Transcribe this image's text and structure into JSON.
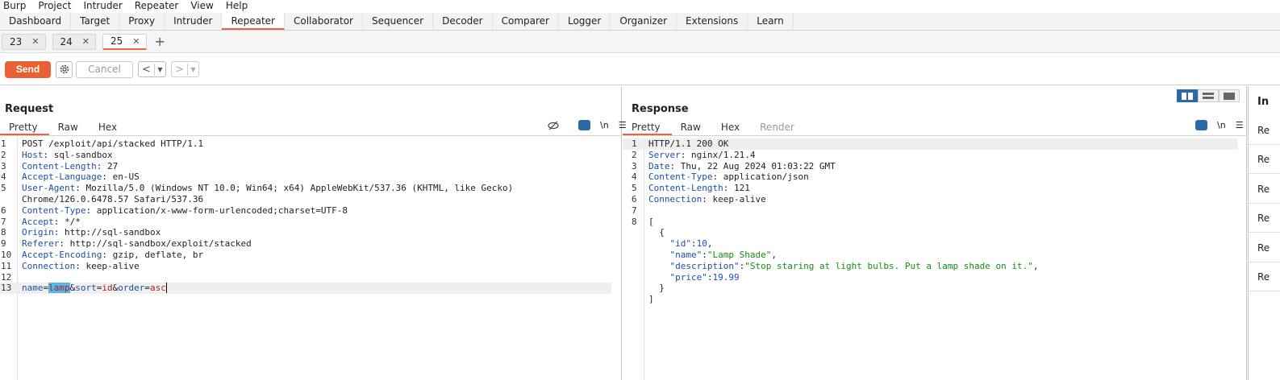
{
  "menu": [
    "Burp",
    "Project",
    "Intruder",
    "Repeater",
    "View",
    "Help"
  ],
  "tabs": [
    "Dashboard",
    "Target",
    "Proxy",
    "Intruder",
    "Repeater",
    "Collaborator",
    "Sequencer",
    "Decoder",
    "Comparer",
    "Logger",
    "Organizer",
    "Extensions",
    "Learn"
  ],
  "active_tab": "Repeater",
  "subtabs": [
    "23",
    "24",
    "25"
  ],
  "toolbar": {
    "send": "Send",
    "cancel": "Cancel",
    "prev": "<",
    "next": ">"
  },
  "request": {
    "title": "Request",
    "tabs": [
      "Pretty",
      "Raw",
      "Hex"
    ],
    "newline_label": "\\n"
  },
  "response": {
    "title": "Response",
    "tabs": [
      "Pretty",
      "Raw",
      "Hex",
      "Render"
    ],
    "newline_label": "\\n"
  },
  "request_lines": [
    "POST /exploit/api/stacked HTTP/1.1",
    "Host: sql-sandbox",
    "Content-Length: 27",
    "Accept-Language: en-US",
    "User-Agent: Mozilla/5.0 (Windows NT 10.0; Win64; x64) AppleWebKit/537.36 (KHTML, like Gecko)",
    "Chrome/126.0.6478.57 Safari/537.36",
    "Content-Type: application/x-www-form-urlencoded;charset=UTF-8",
    "Accept: */*",
    "Origin: http://sql-sandbox",
    "Referer: http://sql-sandbox/exploit/stacked",
    "Accept-Encoding: gzip, deflate, br",
    "Connection: keep-alive",
    "",
    "name=lamp&sort=id&order=asc"
  ],
  "response_lines": [
    "HTTP/1.1 200 OK",
    "Server: nginx/1.21.4",
    "Date: Thu, 22 Aug 2024 01:03:22 GMT",
    "Content-Type: application/json",
    "Content-Length: 121",
    "Connection: keep-alive",
    "",
    "[",
    "  {",
    "    \"id\":10,",
    "    \"name\":\"Lamp Shade\",",
    "    \"description\":\"Stop staring at light bulbs. Put a lamp shade on it.\",",
    "    \"price\":19.99",
    "  }",
    "]"
  ],
  "inspector": {
    "title": "In",
    "items": [
      "Re",
      "Re",
      "Re",
      "Re",
      "Re",
      "Re"
    ]
  }
}
